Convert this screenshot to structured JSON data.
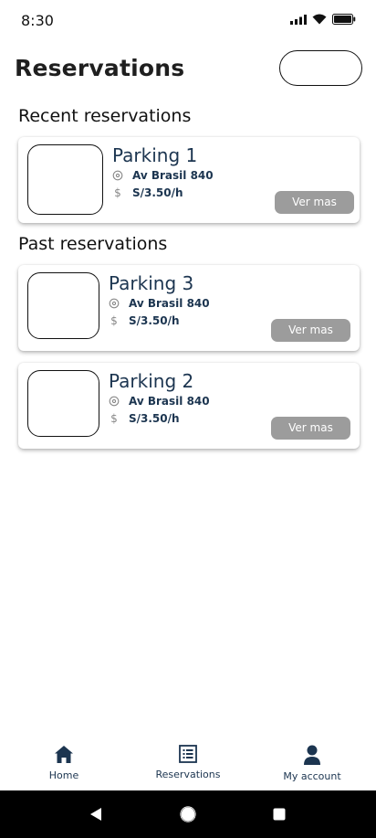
{
  "status_bar": {
    "time": "8:30"
  },
  "header": {
    "title": "Reservations"
  },
  "sections": {
    "recent_title": "Recent reservations",
    "past_title": "Past reservations"
  },
  "cards": [
    {
      "name": "Parking 1",
      "address": "Av Brasil 840",
      "price": "S/3.50/h",
      "button": "Ver mas"
    },
    {
      "name": "Parking 3",
      "address": "Av Brasil 840",
      "price": "S/3.50/h",
      "button": "Ver mas"
    },
    {
      "name": "Parking 2",
      "address": "Av Brasil 840",
      "price": "S/3.50/h",
      "button": "Ver mas"
    }
  ],
  "icons": {
    "location": "location-pin-icon",
    "price": "dollar-icon",
    "home": "home-icon",
    "reservations": "list-icon",
    "account": "person-icon"
  },
  "price_symbol": "$",
  "nav": {
    "home": "Home",
    "reservations": "Reservations",
    "account": "My account"
  },
  "colors": {
    "text_primary": "#1c3550",
    "button_bg": "#9c9c9c",
    "system_bar": "#000000"
  }
}
